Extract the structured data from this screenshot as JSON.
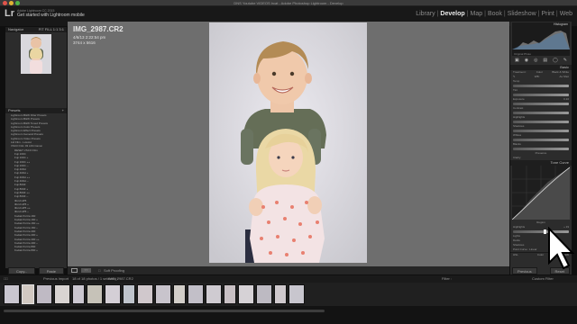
{
  "window": {
    "title": "DNS Youtube VIDEOS lrcat - Adobe Photoshop Lightroom - Develop"
  },
  "identity": {
    "line1": "Adobe Lightroom CC 2015",
    "line2": "Get started with Lightroom mobile"
  },
  "modules": [
    "Library",
    "Develop",
    "Map",
    "Book",
    "Slideshow",
    "Print",
    "Web"
  ],
  "module_active": "Develop",
  "navigator": {
    "label": "Navigator",
    "zoom": "FIT FILL 1:1 3:1"
  },
  "presets": {
    "label": "Presets",
    "items": [
      "Lightroom B&W Filter Presets",
      "Lightroom B&W Presets",
      "Lightroom B&W Toned Presets",
      "Lightroom Color Presets",
      "Lightroom Effect Presets",
      "Lightroom General Presets",
      "Lightroom Video Presets",
      "Ltd Film - Lowcut",
      "VSCO Film 03 LR4 Canon",
      "RESET VSCO Film",
      "Fuji 160C",
      "Fuji 160C +",
      "Fuji 160C ++",
      "Fuji 160C --",
      "Fuji 400H",
      "Fuji 400H +",
      "Fuji 400H ++",
      "Fuji 400H --",
      "Fuji 800Z",
      "Fuji 800Z +",
      "Fuji 800Z ++",
      "Fuji 800Z --",
      "Ilford HP5",
      "Ilford HP5 +",
      "Ilford HP5 ++",
      "Ilford HP5 --",
      "Kodak Portra 160",
      "Kodak Portra 160 +",
      "Kodak Portra 160 ++",
      "Kodak Portra 160 --",
      "Kodak Portra 400",
      "Kodak Portra 400 +",
      "Kodak Portra 400 ++",
      "Kodak Portra 400 --",
      "Kodak Portra 800",
      "Kodak Portra 800 +"
    ]
  },
  "left_buttons": {
    "copy": "Copy...",
    "paste": "Paste"
  },
  "image": {
    "filename": "IMG_2987.CR2",
    "date": "4/6/13 2:22:54 pm",
    "dimensions": "3744 x 5616"
  },
  "toolbar": {
    "soft_proofing": "Soft Proofing"
  },
  "right_panel": {
    "histogram_label": "Histogram",
    "original_photo": "Original Photo",
    "basic_label": "Basic",
    "treatment": "Treatment :",
    "color": "Color",
    "bw": "Black & White",
    "wb": "WB :",
    "as_shot": "As Shot",
    "basic_sliders": [
      "Temp",
      "Tint",
      "Exposure",
      "Contrast",
      "Highlights",
      "Shadows",
      "Whites",
      "Blacks"
    ],
    "exposure_value": "0.10",
    "presence": "Presence",
    "presence_sliders": [
      "Clarity",
      "Vibrance",
      "Saturation"
    ],
    "tone_curve_label": "Tone Curve",
    "region": "Region",
    "region_sliders": [
      "Highlights",
      "Lights",
      "Darks",
      "Shadows"
    ],
    "highlights_value": "+ 19",
    "point_curve": "Point Curve : Linear",
    "hsl_label": "HSL",
    "color_label": "Color",
    "bw_label": "B&W"
  },
  "right_buttons": {
    "previous": "Previous",
    "reset": "Reset"
  },
  "filmbar": {
    "source": "Previous Import",
    "count": "18 of 18 photos / 1 selected /",
    "selected_name": "IMG_2987.CR2",
    "filter_label": "Filter :",
    "filter_value": "Custom Filter"
  },
  "colors": {
    "accent": "#d8d8d8",
    "panel": "#2c2c2c",
    "canvas": "#6e6e6e"
  }
}
